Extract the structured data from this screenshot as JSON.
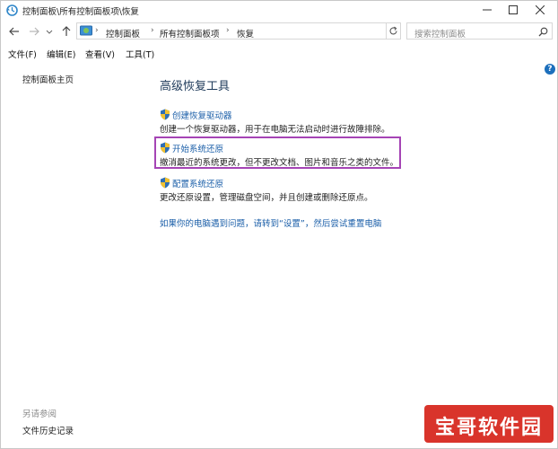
{
  "window": {
    "title": "控制面板\\所有控制面板项\\恢复"
  },
  "address_bar": {
    "breadcrumbs": [
      "控制面板",
      "所有控制面板项",
      "恢复"
    ]
  },
  "search": {
    "placeholder": "搜索控制面板"
  },
  "menu": {
    "items": [
      "文件(F)",
      "编辑(E)",
      "查看(V)",
      "工具(T)"
    ]
  },
  "sidebar": {
    "home": "控制面板主页",
    "see_also": "另请参阅",
    "file_history": "文件历史记录"
  },
  "main": {
    "heading": "高级恢复工具",
    "tools": [
      {
        "label": "创建恢复驱动器",
        "description": "创建一个恢复驱动器，用于在电脑无法启动时进行故障排除。"
      },
      {
        "label": "开始系统还原",
        "description": "撤消最近的系统更改，但不更改文档、图片和音乐之类的文件。"
      },
      {
        "label": "配置系统还原",
        "description": "更改还原设置，管理磁盘空间，并且创建或删除还原点。"
      }
    ],
    "reset_link": "如果你的电脑遇到问题，请转到“设置”，然后尝试重置电脑"
  },
  "watermark": {
    "text": "宝哥软件园"
  },
  "colors": {
    "link": "#1a5ea8",
    "highlight_border": "#a544b5",
    "watermark_bg": "#d9342b"
  }
}
